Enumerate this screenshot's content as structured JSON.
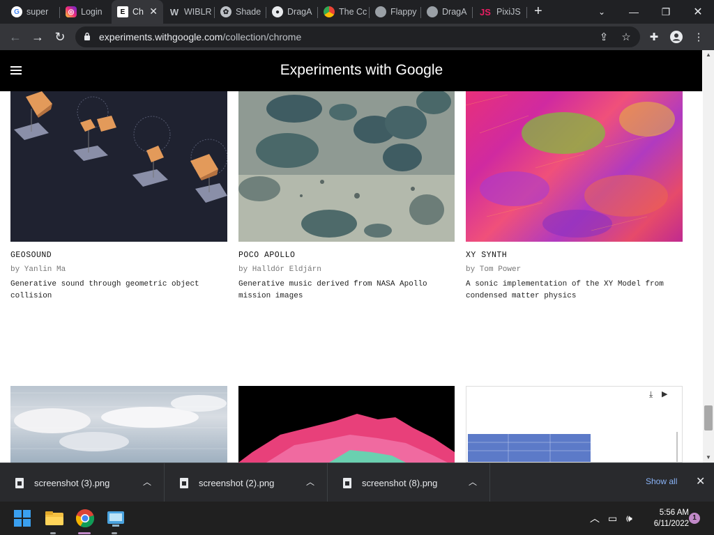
{
  "browser": {
    "tabs": [
      {
        "label": "super",
        "icon": "google-icon"
      },
      {
        "label": "Login",
        "icon": "instagram-icon"
      },
      {
        "label": "Ch",
        "icon": "experiments-icon",
        "active": true
      },
      {
        "label": "WIBLR",
        "icon": "w-icon"
      },
      {
        "label": "Shade",
        "icon": "shader-icon"
      },
      {
        "label": "DragA",
        "icon": "github-icon"
      },
      {
        "label": "The Cc",
        "icon": "chrome-icon"
      },
      {
        "label": "Flappy",
        "icon": "globe-icon"
      },
      {
        "label": "DragA",
        "icon": "globe-icon"
      },
      {
        "label": "PixiJS",
        "icon": "pixijs-icon"
      }
    ],
    "url_host": "experiments.withgoogle.com",
    "url_path": "/collection/chrome"
  },
  "site": {
    "title": "Experiments with Google"
  },
  "cards": [
    {
      "title": "GEOSOUND",
      "author": "by Yanlin Ma",
      "description": "Generative sound through geometric object collision"
    },
    {
      "title": "POCO APOLLO",
      "author": "by Halldór Eldjárn",
      "description": "Generative music derived from NASA Apollo mission images"
    },
    {
      "title": "XY SYNTH",
      "author": "by Tom Power",
      "description": "A sonic implementation of the XY Model from condensed matter physics"
    }
  ],
  "downloads": {
    "items": [
      {
        "name": "screenshot (3).png"
      },
      {
        "name": "screenshot (2).png"
      },
      {
        "name": "screenshot (8).png"
      }
    ],
    "show_all": "Show all"
  },
  "taskbar": {
    "time": "5:56 AM",
    "date": "6/11/2022",
    "notifications": "1"
  }
}
